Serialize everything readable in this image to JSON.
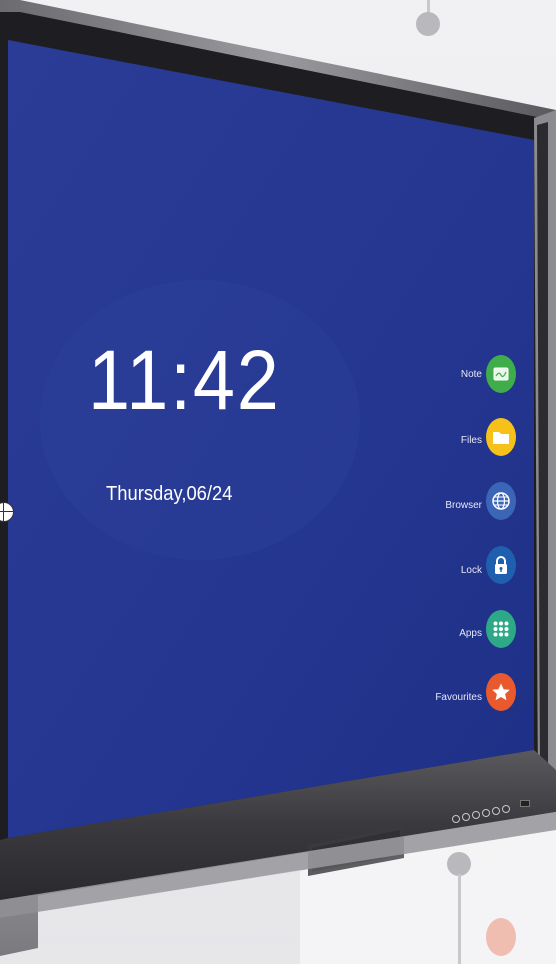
{
  "screen": {
    "time": "11:42",
    "date": "Thursday,06/24",
    "background_color": "#233792"
  },
  "sidebar": {
    "items": [
      {
        "label": "Note",
        "icon": "note-icon",
        "color": "#3fae4a"
      },
      {
        "label": "Files",
        "icon": "folder-icon",
        "color": "#f6c21a"
      },
      {
        "label": "Browser",
        "icon": "globe-icon",
        "color": "#3b66b8"
      },
      {
        "label": "Lock",
        "icon": "lock-icon",
        "color": "#1f5fb0"
      },
      {
        "label": "Apps",
        "icon": "apps-grid-icon",
        "color": "#2ea987"
      },
      {
        "label": "Favourites",
        "icon": "star-icon",
        "color": "#e85a2e"
      }
    ]
  },
  "hardware": {
    "front_buttons": 6,
    "bezel_color": "#2a2a2e"
  }
}
